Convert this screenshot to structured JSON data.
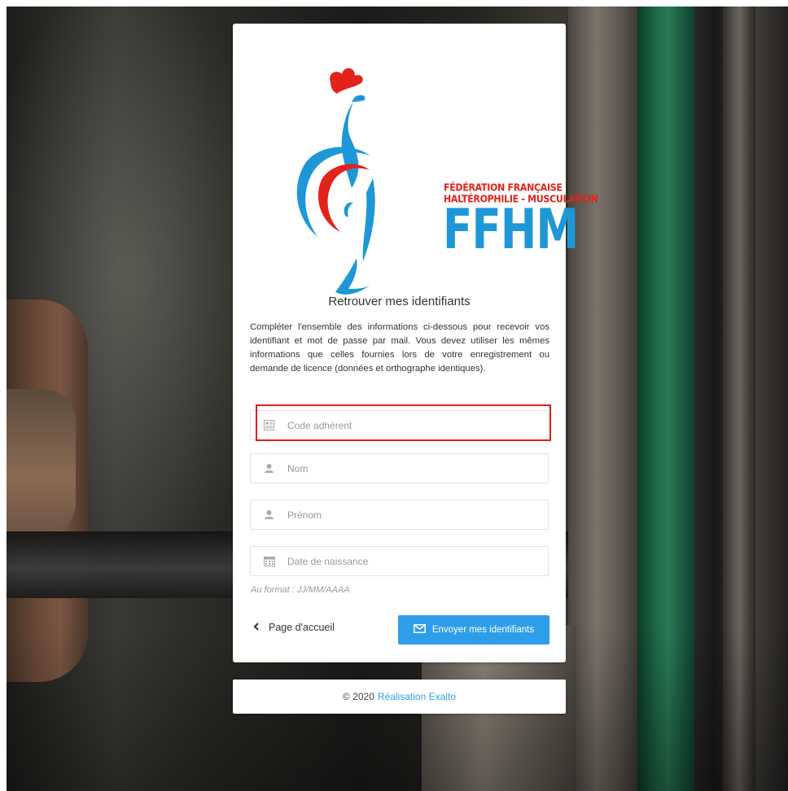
{
  "brand": {
    "line1": "FÉDÉRATION FRANÇAISE",
    "line2": "HALTÉROPHILIE - MUSCULATION",
    "acronym": "FFHM",
    "colors": {
      "red": "#e2231a",
      "blue": "#1e97d6"
    }
  },
  "form": {
    "title": "Retrouver mes identifiants",
    "description": "Compléter l'ensemble des informations ci-dessous pour recevoir vos identifiant et mot de passe par mail. Vous devez utiliser les mêmes informations que celles fournies lors de votre enregistrement ou demande de licence (données et orthographe identiques).",
    "fields": [
      {
        "placeholder": "Code adhérent",
        "value": "",
        "icon": "id-card-icon"
      },
      {
        "placeholder": "Nom",
        "value": "",
        "icon": "user-icon"
      },
      {
        "placeholder": "Prénom",
        "value": "",
        "icon": "user-icon"
      },
      {
        "placeholder": "Date de naissance",
        "value": "",
        "icon": "calendar-icon"
      }
    ],
    "date_hint": "Au format : JJ/MM/AAAA",
    "back_label": "Page d'accueil",
    "submit_label": "Envoyer mes identifiants",
    "accent_color": "#2f9ee8",
    "highlight_color": "#e01b1b"
  },
  "footer": {
    "copyright": "© 2020",
    "link_label": "Réalisation Exalto"
  }
}
